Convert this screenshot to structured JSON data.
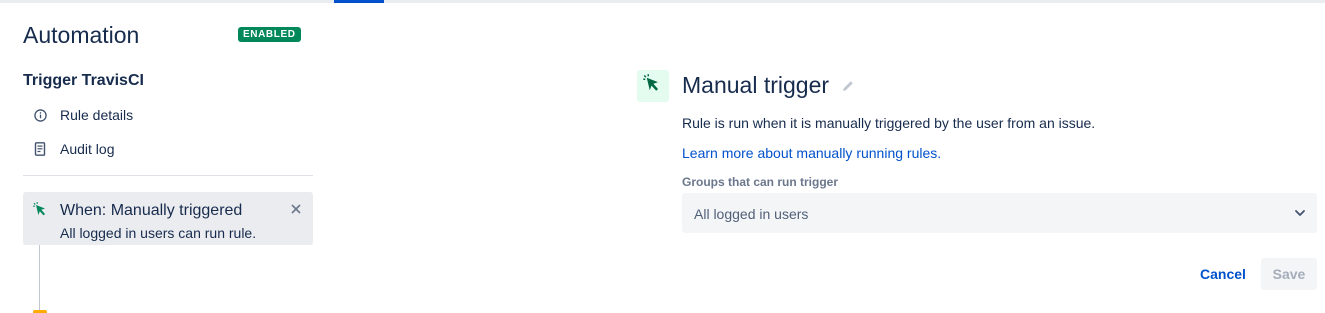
{
  "header": {
    "app_title": "Automation",
    "status_badge": "ENABLED"
  },
  "sidebar": {
    "rule_name": "Trigger TravisCI",
    "items": [
      {
        "label": "Rule details",
        "icon": "info-icon"
      },
      {
        "label": "Audit log",
        "icon": "document-icon"
      }
    ],
    "trigger_card": {
      "title": "When: Manually triggered",
      "description": "All logged in users can run rule.",
      "icon": "cursor-click-icon"
    }
  },
  "detail": {
    "title": "Manual trigger",
    "description": "Rule is run when it is manually triggered by the user from an issue.",
    "link_text": "Learn more about manually running rules.",
    "field_label": "Groups that can run trigger",
    "select_value": "All logged in users",
    "cancel_label": "Cancel",
    "save_label": "Save"
  },
  "colors": {
    "accent": "#0052cc",
    "success": "#00875a",
    "text": "#172b4d",
    "muted": "#6b778c"
  }
}
